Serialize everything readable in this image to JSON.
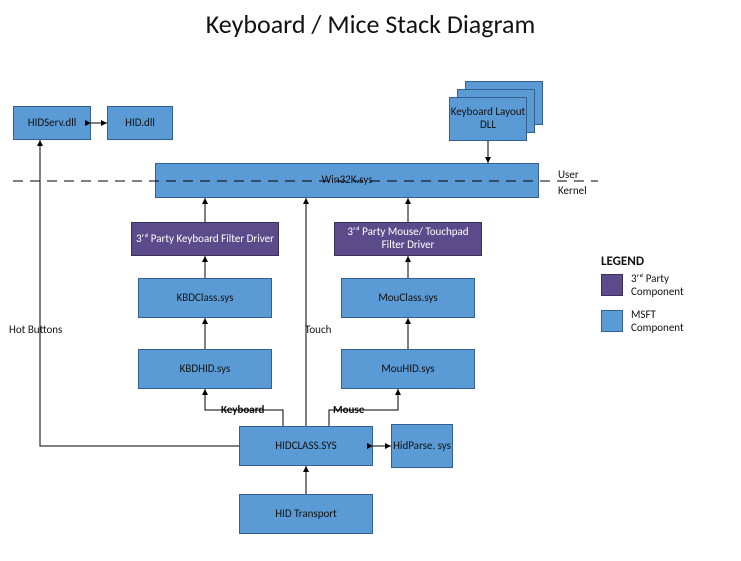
{
  "title": "Keyboard / Mice Stack Diagram",
  "boxes": {
    "hidserv": "HIDServ.dll",
    "hiddll": "HID.dll",
    "kbdlayout": "Keyboard Layout DLL",
    "win32k": "Win32K.sys",
    "kbdfilter": "3ʳᵈ Party Keyboard Filter Driver",
    "mousefilter": "3ʳᵈ Party Mouse/ Touchpad Filter Driver",
    "kbdclass": "KBDClass.sys",
    "mouclass": "MouClass.sys",
    "kbdhid": "KBDHID.sys",
    "mouhid": "MouHID.sys",
    "hidclass": "HIDCLASS.SYS",
    "hidparse": "HidParse. sys",
    "hidtransport": "HID Transport"
  },
  "labels": {
    "user": "User",
    "kernel": "Kernel",
    "hotbuttons": "Hot Buttons",
    "touch": "Touch",
    "keyboard": "Keyboard",
    "mouse": "Mouse"
  },
  "legend": {
    "title": "LEGEND",
    "third_party": "3ʳᵈ Party Component",
    "msft": "MSFT Component"
  },
  "colors": {
    "msft": "#5b9bd5",
    "msft_border": "#365f91",
    "third_party": "#5c4b8b",
    "third_party_border": "#3c305b"
  }
}
